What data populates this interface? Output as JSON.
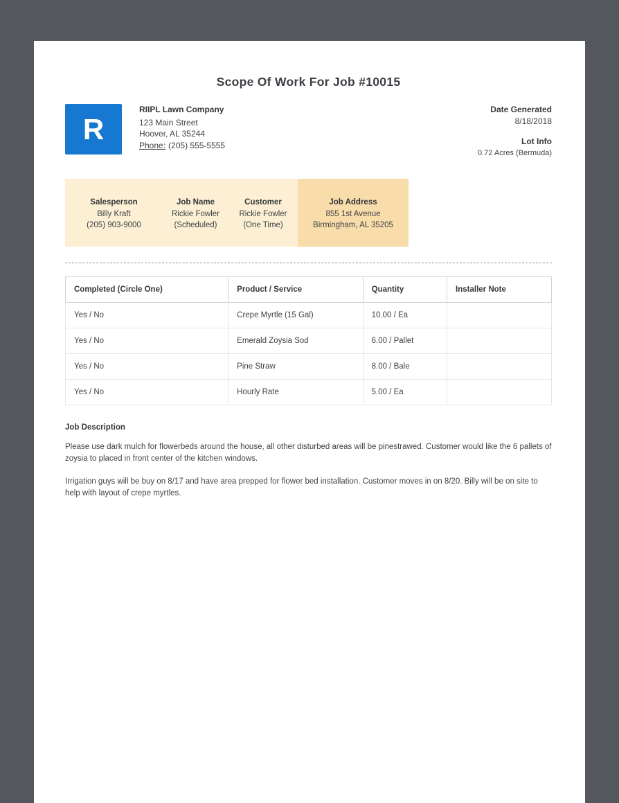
{
  "page": {
    "title": "Scope Of Work For Job #10015"
  },
  "company": {
    "logo_letter": "R",
    "name": "RIIPL Lawn Company",
    "address_line1": "123 Main Street",
    "address_line2": "Hoover, AL 35244",
    "phone_label": "Phone:",
    "phone": "(205) 555-5555"
  },
  "meta": {
    "date_generated_label": "Date Generated",
    "date_generated": "8/18/2018",
    "lot_info_label": "Lot Info",
    "lot_info": "0.72 Acres (Bermuda)"
  },
  "info_bar": {
    "columns": [
      {
        "label": "Salesperson",
        "line1": "Billy Kraft",
        "line2": "(205) 903-9000",
        "highlight": false
      },
      {
        "label": "Job Name",
        "line1": "Rickie Fowler",
        "line2": "(Scheduled)",
        "highlight": false
      },
      {
        "label": "Customer",
        "line1": "Rickie Fowler",
        "line2": "(One Time)",
        "highlight": false
      },
      {
        "label": "Job Address",
        "line1": "855 1st Avenue",
        "line2": "Birmingham, AL 35205",
        "highlight": true
      }
    ]
  },
  "work_table": {
    "headers": [
      "Completed (Circle One)",
      "Product / Service",
      "Quantity",
      "Installer Note"
    ],
    "rows": [
      [
        "Yes / No",
        "Crepe Myrtle (15 Gal)",
        "10.00 / Ea",
        ""
      ],
      [
        "Yes / No",
        "Emerald Zoysia Sod",
        "6.00 / Pallet",
        ""
      ],
      [
        "Yes / No",
        "Pine Straw",
        "8.00 / Bale",
        ""
      ],
      [
        "Yes / No",
        "Hourly Rate",
        "5.00 / Ea",
        ""
      ]
    ]
  },
  "job_description": {
    "heading": "Job Description",
    "paragraphs": [
      "Please use dark mulch for flowerbeds around the house, all other disturbed areas will be pinestrawed. Customer would like the 6 pallets of zoysia to placed in front center of the kitchen windows.",
      "Irrigation guys will be buy on 8/17 and have area prepped for flower bed installation. Customer moves in on 8/20. Billy will be on site to help with layout of crepe myrtles."
    ]
  },
  "colors": {
    "accent_blue": "#1778d2",
    "info_bar_bg": "#fcefd4",
    "info_bar_highlight": "#f8dcaa",
    "page_background": "#ffffff",
    "viewer_background": "#54575c"
  }
}
